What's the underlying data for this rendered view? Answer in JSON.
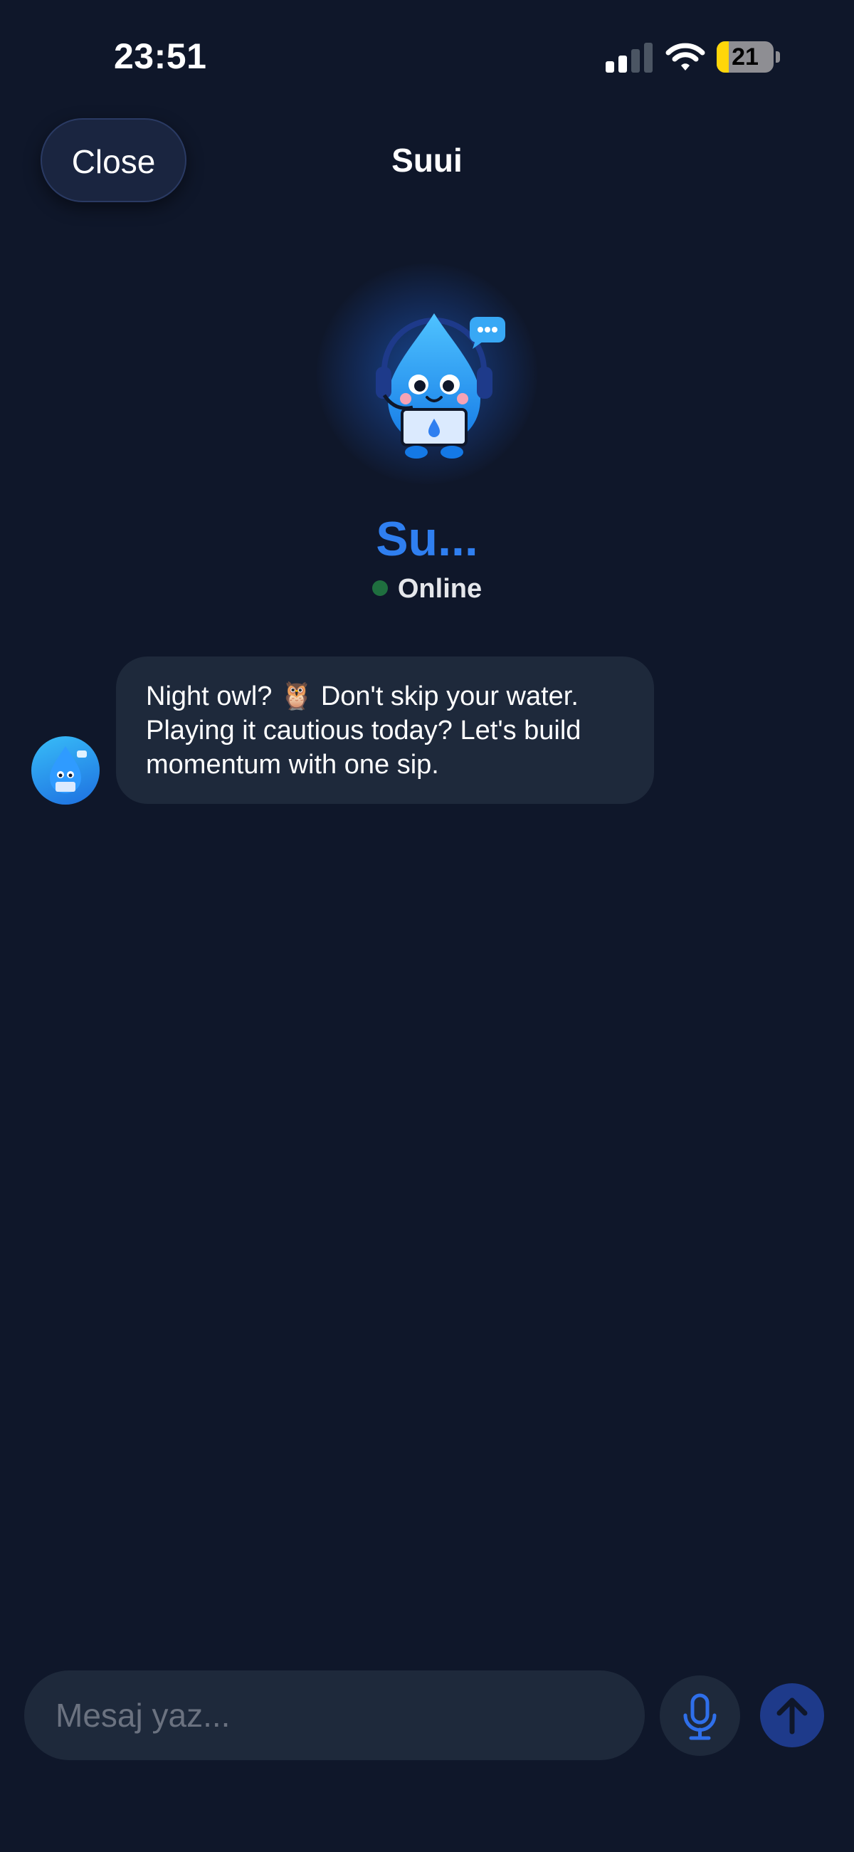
{
  "status_bar": {
    "time": "23:51",
    "battery_level": "21",
    "battery_color": "#ffd60a"
  },
  "header": {
    "close_label": "Close",
    "title": "Suui"
  },
  "agent": {
    "name": "Su...",
    "status": "Online",
    "status_color": "#1f6f3f",
    "name_color": "#2f7ff0",
    "mascot_icon": "water-drop-mascot-with-headset-laptop"
  },
  "messages": [
    {
      "sender": "bot",
      "text": "Night owl? 🦉 Don't skip your water. Playing it cautious today? Let's build momentum with one sip."
    }
  ],
  "composer": {
    "placeholder": "Mesaj yaz...",
    "value": "",
    "mic_icon": "microphone-icon",
    "send_icon": "arrow-up-icon"
  },
  "colors": {
    "background": "#0f172a",
    "bubble": "#1e293b",
    "accent": "#2f7ff0"
  }
}
